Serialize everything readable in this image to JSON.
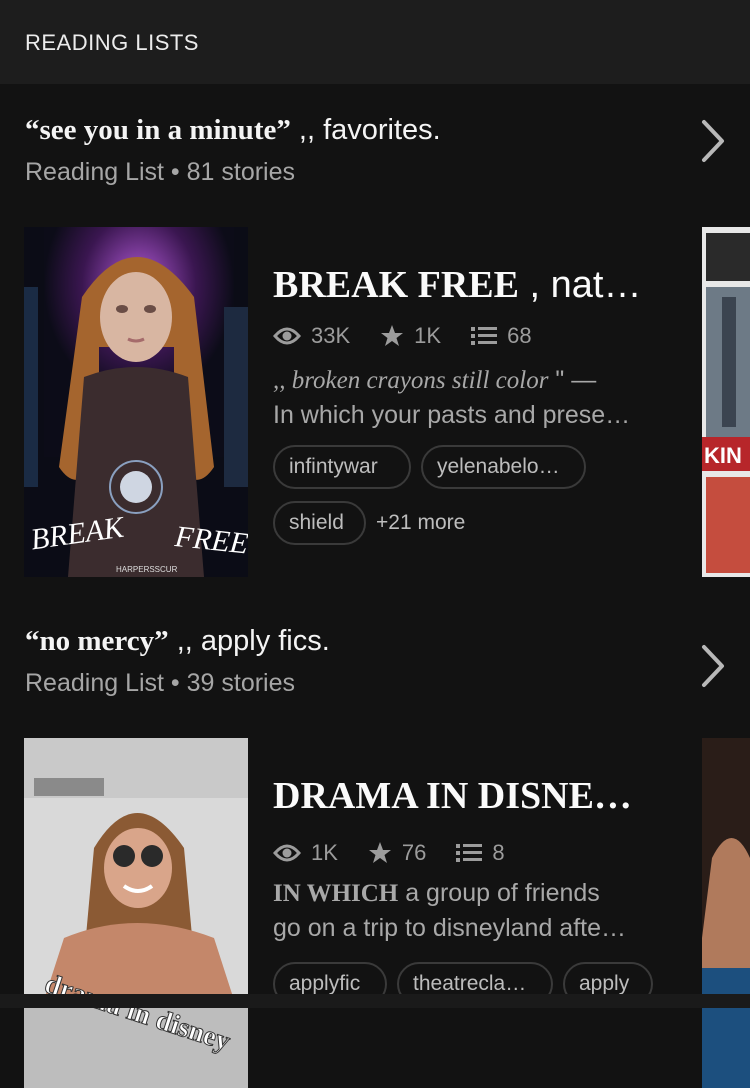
{
  "header": {
    "title": "READING LISTS"
  },
  "lists": [
    {
      "name_quote": "“see you in a minute”",
      "name_rest": " ,, favorites.",
      "subtitle": "Reading List • 81 stories",
      "story": {
        "title_serif": "BREAK FREE",
        "title_rest": " , nat…",
        "views": "33K",
        "votes": "1K",
        "parts": "68",
        "desc_line1_italic": ",, broken crayons still color",
        "desc_line1_rest": " \" —",
        "desc_line2": "In which your pasts and prese…",
        "tags": [
          "infintywar",
          "yelenabelo…",
          "shield"
        ],
        "more": "+21 more",
        "cover_text_left": "BREAK",
        "cover_text_right": "FREE",
        "cover_small": "HARPERSSCUR",
        "side_cover_text": "KIN"
      }
    },
    {
      "name_quote": "“no mercy”",
      "name_rest": " ,, apply fics.",
      "subtitle": "Reading List • 39 stories",
      "story": {
        "title_serif": "DRAMA IN DISNE…",
        "views": "1K",
        "votes": "76",
        "parts": "8",
        "desc_line1_bold": "IN WHICH",
        "desc_line1_rest": " a group of friends",
        "desc_line2": "go on a trip to disneyland afte…",
        "tags": [
          "applyfic",
          "theatrecla…",
          "apply"
        ],
        "cover_text": "drama in disney"
      }
    }
  ],
  "colors": {
    "background": "#121212",
    "header_bg": "#1d1d1d",
    "muted": "#a6a6a6"
  }
}
